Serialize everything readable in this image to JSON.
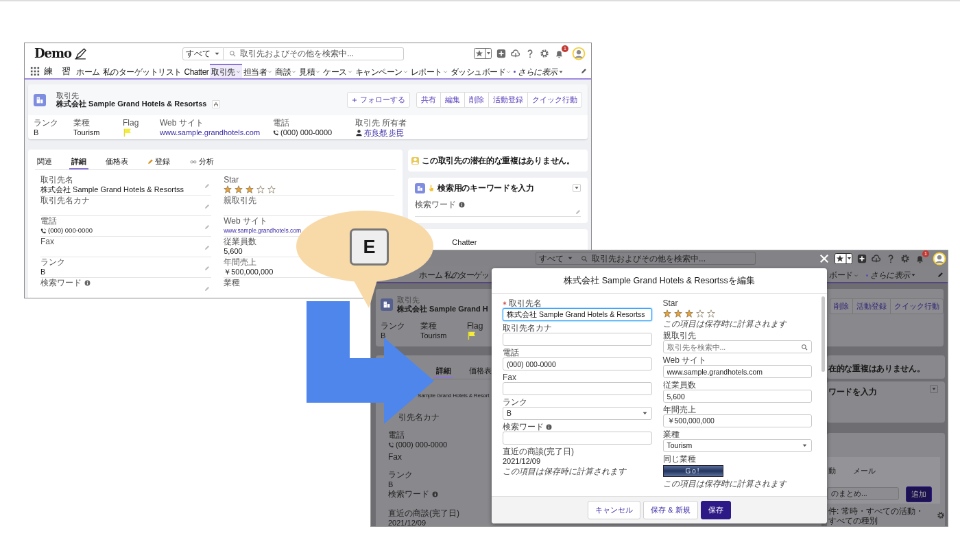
{
  "callout": {
    "key": "E"
  },
  "screen_before": {
    "header": {
      "logo": "Demo",
      "search_scope": "すべて",
      "search_placeholder": "取引先およびその他を検索中...",
      "notification_count": "1"
    },
    "nav": {
      "app_name": "練　習",
      "items": [
        {
          "label": "ホーム",
          "selected": false,
          "dropdown": false,
          "kind": "plain"
        },
        {
          "label": "私のターゲットリスト",
          "selected": false,
          "dropdown": false,
          "kind": "plain"
        },
        {
          "label": "Chatter",
          "selected": false,
          "dropdown": false,
          "kind": "plain"
        },
        {
          "label": "取引先",
          "selected": true,
          "dropdown": true,
          "kind": "plain"
        },
        {
          "label": "担当者",
          "selected": false,
          "dropdown": true,
          "kind": "plain"
        },
        {
          "label": "商談",
          "selected": false,
          "dropdown": true,
          "kind": "plain"
        },
        {
          "label": "見積",
          "selected": false,
          "dropdown": true,
          "kind": "plain"
        },
        {
          "label": "ケース",
          "selected": false,
          "dropdown": true,
          "kind": "plain"
        },
        {
          "label": "キャンペーン",
          "selected": false,
          "dropdown": true,
          "kind": "plain"
        },
        {
          "label": "レポート",
          "selected": false,
          "dropdown": true,
          "kind": "plain"
        },
        {
          "label": "ダッシュボード",
          "selected": false,
          "dropdown": true,
          "kind": "plain"
        },
        {
          "label": "さらに表示",
          "selected": false,
          "dropdown": true,
          "kind": "more"
        }
      ]
    },
    "record": {
      "object_label": "取引先",
      "title": "株式会社 Sample Grand Hotels & Resortss",
      "follow_label": "フォローする",
      "actions": [
        "共有",
        "編集",
        "削除",
        "活動登録",
        "クイック行動"
      ],
      "highlights": [
        {
          "label": "ランク",
          "value": "B",
          "kind": "text"
        },
        {
          "label": "業種",
          "value": "Tourism",
          "kind": "text"
        },
        {
          "label": "Flag",
          "kind": "flag"
        },
        {
          "label": "Web サイト",
          "value": "www.sample.grandhotels.com",
          "kind": "link"
        },
        {
          "label": "電話",
          "value": "(000) 000-0000",
          "kind": "phone"
        },
        {
          "label": "取引先 所有者",
          "value": "布良都 歩臣",
          "kind": "user"
        }
      ]
    },
    "detail_tabs": [
      {
        "label": "関連",
        "selected": false,
        "kind": "plain"
      },
      {
        "label": "詳細",
        "selected": true,
        "kind": "plain"
      },
      {
        "label": "価格表",
        "selected": false,
        "kind": "plain"
      },
      {
        "label": "登録",
        "selected": false,
        "kind": "pencil"
      },
      {
        "label": "分析",
        "selected": false,
        "kind": "glasses"
      }
    ],
    "fields_left": [
      {
        "label": "取引先名",
        "value": "株式会社 Sample Grand Hotels & Resortss",
        "kind": "text"
      },
      {
        "label": "取引先名カナ",
        "kind": "text"
      },
      {
        "label": "電話",
        "value": "(000) 000-0000",
        "kind": "phone"
      },
      {
        "label": "Fax",
        "kind": "text"
      },
      {
        "label": "ランク",
        "value": "B",
        "kind": "text"
      },
      {
        "label": "検索ワード",
        "kind": "info"
      }
    ],
    "fields_right": [
      {
        "label": "Star",
        "kind": "stars",
        "stars": 3
      },
      {
        "label": "親取引先",
        "kind": "text"
      },
      {
        "label": "Web サイト",
        "value": "www.sample.grandhotels.com",
        "kind": "link"
      },
      {
        "label": "従業員数",
        "value": "5,600",
        "kind": "text"
      },
      {
        "label": "年間売上",
        "value": "￥500,000,000",
        "kind": "text"
      },
      {
        "label": "業種",
        "kind": "text"
      }
    ],
    "sidebar": {
      "duplicate_message": "この取引先の潜在的な重複はありません。",
      "keyword_card_title": "検索用のキーワードを入力",
      "keyword_field_label": "検索ワード",
      "chatter_label": "Chatter"
    }
  },
  "screen_after": {
    "header": {
      "search_scope": "すべて",
      "search_placeholder": "取引先およびその他を検索中...",
      "notification_count": "1"
    },
    "nav_items": [
      {
        "label": "ホーム",
        "dropdown": false,
        "kind": "plain"
      },
      {
        "label": "私のターゲッ",
        "dropdown": false,
        "kind": "plain"
      },
      {
        "label": "ボード",
        "dropdown": true,
        "kind": "plain"
      },
      {
        "label": "さらに表示",
        "dropdown": true,
        "kind": "more"
      }
    ],
    "record": {
      "object_label": "取引先",
      "title": "株式会社 Sample Grand H",
      "actions": [
        "削除",
        "活動登録",
        "クイック行動"
      ],
      "highlights": [
        {
          "label": "ランク",
          "value": "B",
          "kind": "text"
        },
        {
          "label": "業種",
          "value": "Tourism",
          "kind": "text"
        },
        {
          "label": "Flag",
          "kind": "flag"
        }
      ]
    },
    "detail_tabs": [
      {
        "label": "詳細",
        "selected": true
      },
      {
        "label": "価格表",
        "selected": false
      }
    ],
    "fields": [
      {
        "value": "Sample Grand Hotels & Resort",
        "kind": "text"
      },
      {
        "label": "引先名カナ",
        "kind": "text"
      },
      {
        "label": "電話",
        "value": "(000) 000-0000",
        "kind": "phone"
      },
      {
        "label": "Fax",
        "kind": "text"
      },
      {
        "label": "ランク",
        "value": "B",
        "kind": "text"
      },
      {
        "label": "検索ワード",
        "kind": "info"
      },
      {
        "label": "直近の商談(完了日)",
        "value": "2021/12/09",
        "kind": "text"
      }
    ],
    "sidebar": {
      "duplicate_message": "在的な重複はありません。",
      "keyword_card_title": "ワードを入力",
      "activity_tabs": [
        "動",
        "メール"
      ],
      "activity_input_text": "のまとめ...",
      "add_button": "追加",
      "filter_text": "件: 常時・すべての活動・すべての種別"
    },
    "modal": {
      "title": "株式会社 Sample Grand Hotels & Resortssを編集",
      "fields_left": [
        {
          "label": "取引先名",
          "kind": "input",
          "required": true,
          "focused": true,
          "value": "株式会社 Sample Grand Hotels & Resortss"
        },
        {
          "label": "取引先名カナ",
          "kind": "input",
          "required": false,
          "focused": false
        },
        {
          "label": "電話",
          "kind": "input",
          "required": false,
          "focused": false,
          "value": "(000) 000-0000"
        },
        {
          "label": "Fax",
          "kind": "input",
          "required": false,
          "focused": false
        },
        {
          "label": "ランク",
          "kind": "select",
          "required": false,
          "focused": false,
          "value": "B"
        },
        {
          "label": "検索ワード",
          "kind": "input",
          "required": false,
          "focused": false,
          "info": true
        },
        {
          "label": "直近の商談(完了日)",
          "kind": "readonly",
          "required": false,
          "focused": false,
          "value": "2021/12/09",
          "note": "この項目は保存時に計算されます"
        }
      ],
      "fields_right": [
        {
          "label": "Star",
          "kind": "stars",
          "required": false,
          "focused": false,
          "stars": 3,
          "note": "この項目は保存時に計算されます"
        },
        {
          "label": "親取引先",
          "kind": "lookup",
          "required": false,
          "focused": false,
          "placeholder": "取引先を検索中..."
        },
        {
          "label": "Web サイト",
          "kind": "input",
          "required": false,
          "focused": false,
          "value": "www.sample.grandhotels.com"
        },
        {
          "label": "従業員数",
          "kind": "input",
          "required": false,
          "focused": false,
          "value": "5,600"
        },
        {
          "label": "年間売上",
          "kind": "input",
          "required": false,
          "focused": false,
          "value": "￥500,000,000"
        },
        {
          "label": "業種",
          "kind": "select",
          "required": false,
          "focused": false,
          "value": "Tourism"
        },
        {
          "label": "同じ業種",
          "kind": "button",
          "required": false,
          "focused": false,
          "button_label": "Go!",
          "note": "この項目は保存時に計算されます"
        }
      ],
      "footer_buttons": [
        {
          "label": "キャンセル",
          "kind": "neutral"
        },
        {
          "label": "保存 & 新規",
          "kind": "neutral"
        },
        {
          "label": "保存",
          "kind": "brand"
        }
      ]
    }
  }
}
